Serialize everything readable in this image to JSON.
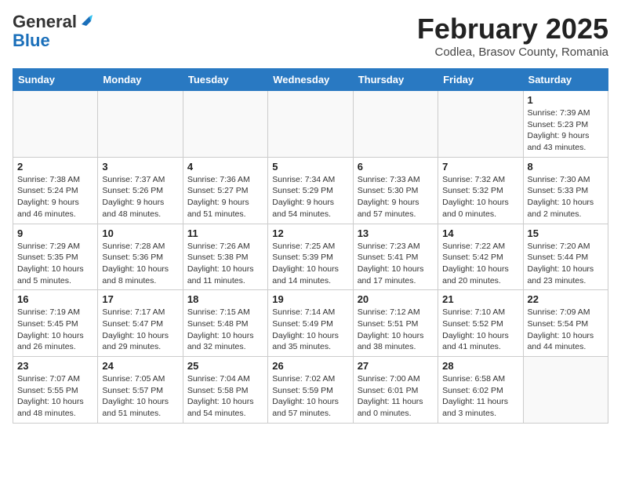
{
  "header": {
    "logo_general": "General",
    "logo_blue": "Blue",
    "month_title": "February 2025",
    "location": "Codlea, Brasov County, Romania"
  },
  "days_of_week": [
    "Sunday",
    "Monday",
    "Tuesday",
    "Wednesday",
    "Thursday",
    "Friday",
    "Saturday"
  ],
  "weeks": [
    [
      {
        "num": "",
        "info": ""
      },
      {
        "num": "",
        "info": ""
      },
      {
        "num": "",
        "info": ""
      },
      {
        "num": "",
        "info": ""
      },
      {
        "num": "",
        "info": ""
      },
      {
        "num": "",
        "info": ""
      },
      {
        "num": "1",
        "info": "Sunrise: 7:39 AM\nSunset: 5:23 PM\nDaylight: 9 hours and 43 minutes."
      }
    ],
    [
      {
        "num": "2",
        "info": "Sunrise: 7:38 AM\nSunset: 5:24 PM\nDaylight: 9 hours and 46 minutes."
      },
      {
        "num": "3",
        "info": "Sunrise: 7:37 AM\nSunset: 5:26 PM\nDaylight: 9 hours and 48 minutes."
      },
      {
        "num": "4",
        "info": "Sunrise: 7:36 AM\nSunset: 5:27 PM\nDaylight: 9 hours and 51 minutes."
      },
      {
        "num": "5",
        "info": "Sunrise: 7:34 AM\nSunset: 5:29 PM\nDaylight: 9 hours and 54 minutes."
      },
      {
        "num": "6",
        "info": "Sunrise: 7:33 AM\nSunset: 5:30 PM\nDaylight: 9 hours and 57 minutes."
      },
      {
        "num": "7",
        "info": "Sunrise: 7:32 AM\nSunset: 5:32 PM\nDaylight: 10 hours and 0 minutes."
      },
      {
        "num": "8",
        "info": "Sunrise: 7:30 AM\nSunset: 5:33 PM\nDaylight: 10 hours and 2 minutes."
      }
    ],
    [
      {
        "num": "9",
        "info": "Sunrise: 7:29 AM\nSunset: 5:35 PM\nDaylight: 10 hours and 5 minutes."
      },
      {
        "num": "10",
        "info": "Sunrise: 7:28 AM\nSunset: 5:36 PM\nDaylight: 10 hours and 8 minutes."
      },
      {
        "num": "11",
        "info": "Sunrise: 7:26 AM\nSunset: 5:38 PM\nDaylight: 10 hours and 11 minutes."
      },
      {
        "num": "12",
        "info": "Sunrise: 7:25 AM\nSunset: 5:39 PM\nDaylight: 10 hours and 14 minutes."
      },
      {
        "num": "13",
        "info": "Sunrise: 7:23 AM\nSunset: 5:41 PM\nDaylight: 10 hours and 17 minutes."
      },
      {
        "num": "14",
        "info": "Sunrise: 7:22 AM\nSunset: 5:42 PM\nDaylight: 10 hours and 20 minutes."
      },
      {
        "num": "15",
        "info": "Sunrise: 7:20 AM\nSunset: 5:44 PM\nDaylight: 10 hours and 23 minutes."
      }
    ],
    [
      {
        "num": "16",
        "info": "Sunrise: 7:19 AM\nSunset: 5:45 PM\nDaylight: 10 hours and 26 minutes."
      },
      {
        "num": "17",
        "info": "Sunrise: 7:17 AM\nSunset: 5:47 PM\nDaylight: 10 hours and 29 minutes."
      },
      {
        "num": "18",
        "info": "Sunrise: 7:15 AM\nSunset: 5:48 PM\nDaylight: 10 hours and 32 minutes."
      },
      {
        "num": "19",
        "info": "Sunrise: 7:14 AM\nSunset: 5:49 PM\nDaylight: 10 hours and 35 minutes."
      },
      {
        "num": "20",
        "info": "Sunrise: 7:12 AM\nSunset: 5:51 PM\nDaylight: 10 hours and 38 minutes."
      },
      {
        "num": "21",
        "info": "Sunrise: 7:10 AM\nSunset: 5:52 PM\nDaylight: 10 hours and 41 minutes."
      },
      {
        "num": "22",
        "info": "Sunrise: 7:09 AM\nSunset: 5:54 PM\nDaylight: 10 hours and 44 minutes."
      }
    ],
    [
      {
        "num": "23",
        "info": "Sunrise: 7:07 AM\nSunset: 5:55 PM\nDaylight: 10 hours and 48 minutes."
      },
      {
        "num": "24",
        "info": "Sunrise: 7:05 AM\nSunset: 5:57 PM\nDaylight: 10 hours and 51 minutes."
      },
      {
        "num": "25",
        "info": "Sunrise: 7:04 AM\nSunset: 5:58 PM\nDaylight: 10 hours and 54 minutes."
      },
      {
        "num": "26",
        "info": "Sunrise: 7:02 AM\nSunset: 5:59 PM\nDaylight: 10 hours and 57 minutes."
      },
      {
        "num": "27",
        "info": "Sunrise: 7:00 AM\nSunset: 6:01 PM\nDaylight: 11 hours and 0 minutes."
      },
      {
        "num": "28",
        "info": "Sunrise: 6:58 AM\nSunset: 6:02 PM\nDaylight: 11 hours and 3 minutes."
      },
      {
        "num": "",
        "info": ""
      }
    ]
  ]
}
